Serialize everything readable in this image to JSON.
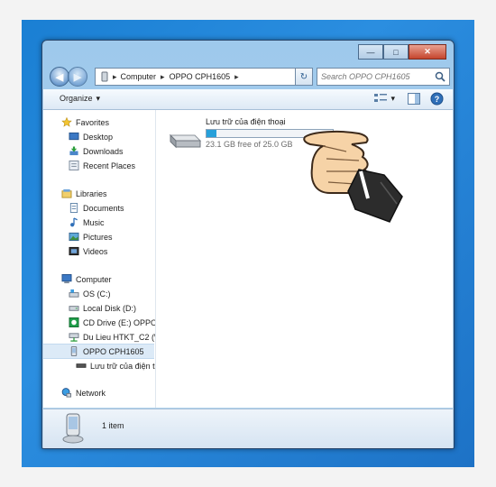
{
  "window": {
    "controls": {
      "minimize": "—",
      "maximize": "□",
      "close": "✕"
    }
  },
  "address_bar": {
    "segments": [
      "Computer",
      "OPPO CPH1605"
    ],
    "separator": "▸",
    "dropdown": "▾",
    "refresh": "↻"
  },
  "search": {
    "placeholder": "Search OPPO CPH1605",
    "icon": "magnifier-icon"
  },
  "toolbar": {
    "organize": "Organize",
    "organize_arrow": "▾"
  },
  "sidebar": {
    "favorites": {
      "header": "Favorites",
      "items": [
        "Desktop",
        "Downloads",
        "Recent Places"
      ]
    },
    "libraries": {
      "header": "Libraries",
      "items": [
        "Documents",
        "Music",
        "Pictures",
        "Videos"
      ]
    },
    "computer": {
      "header": "Computer",
      "items": [
        "OS (C:)",
        "Local Disk (D:)",
        "CD Drive (E:) OPPO I",
        "Du Lieu HTKT_C2 (\\",
        "OPPO CPH1605",
        "Lưu trữ của điện th"
      ]
    },
    "network": {
      "header": "Network"
    }
  },
  "storage": {
    "name": "Lưu trữ của điện thoại",
    "free_text": "23.1 GB free of 25.0 GB",
    "used_fraction": 0.076,
    "bar_color": "#26a0da"
  },
  "status_bar": {
    "count": "1 item"
  },
  "colors": {
    "accent": "#1a7fd3",
    "selection": "#dceaf7"
  }
}
